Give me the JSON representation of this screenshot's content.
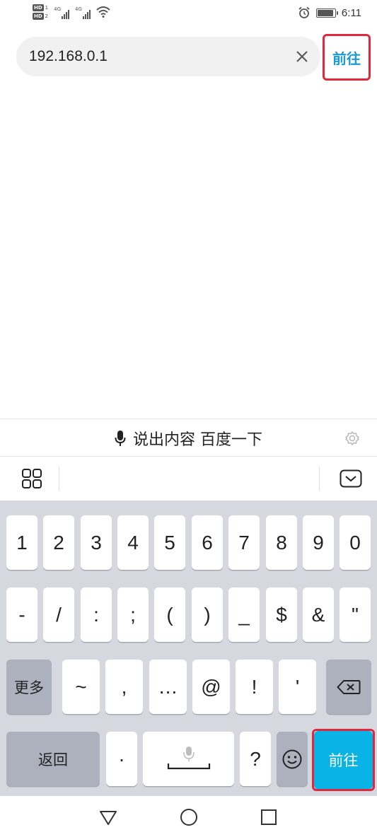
{
  "status_bar": {
    "time": "6:11",
    "hd_badge": "HD",
    "sim1": "1",
    "sim2": "2",
    "network_1": "4G",
    "network_2": "4G",
    "icons": [
      "signal-icon",
      "wifi-icon",
      "alarm-icon",
      "battery-icon"
    ],
    "battery_level": 0.9
  },
  "address_bar": {
    "url": "192.168.0.1",
    "go_label": "前往"
  },
  "voice_bar": {
    "text": "说出内容 百度一下"
  },
  "keyboard": {
    "row1": [
      "1",
      "2",
      "3",
      "4",
      "5",
      "6",
      "7",
      "8",
      "9",
      "0"
    ],
    "row2": [
      "-",
      "/",
      ":",
      ";",
      "(",
      ")",
      "_",
      "$",
      "&",
      "\""
    ],
    "more_label": "更多",
    "row3": [
      "~",
      ",",
      "…",
      "@",
      "!",
      "'"
    ],
    "back_label": "返回",
    "dot": "·",
    "question": "?",
    "go_label": "前往"
  },
  "colors": {
    "accent": "#1a9ad6",
    "go_key": "#0ab3e6",
    "highlight": "#e0283c",
    "keyboard_bg": "#d6d8e0",
    "function_key": "#adb1bd"
  }
}
